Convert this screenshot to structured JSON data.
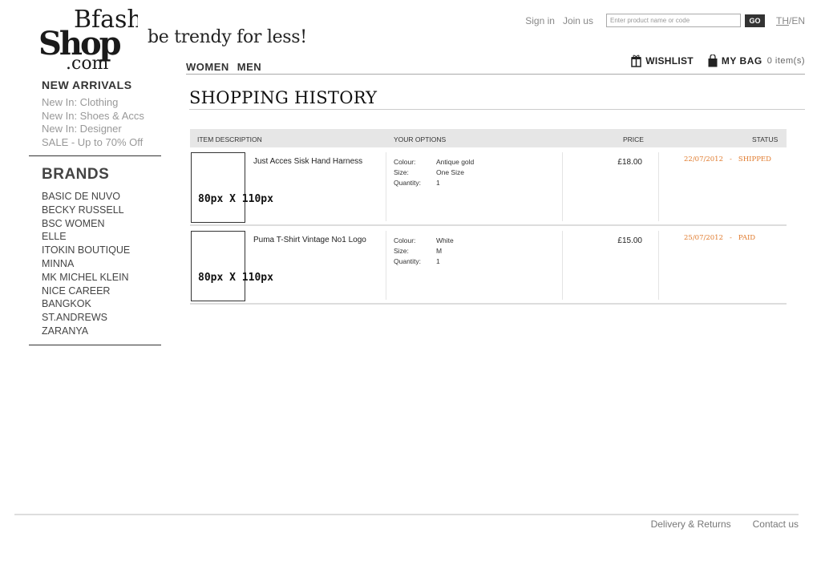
{
  "brand": {
    "logo_line1": "Bfash",
    "logo_line2": "Shop",
    "logo_line3": ".com",
    "tagline": "be trendy for less!"
  },
  "topnav": {
    "sign_in": "Sign in",
    "join_us": "Join us",
    "search_placeholder": "Enter product name or code",
    "go_label": "GO",
    "lang_th": "TH",
    "lang_sep": "/",
    "lang_en": "EN"
  },
  "mainnav": {
    "women": "WOMEN",
    "men": "MEN"
  },
  "util": {
    "wishlist": "WISHLIST",
    "my_bag": "MY BAG",
    "bag_count": "0 item(s)"
  },
  "sidebar": {
    "new_arrivals_heading": "NEW ARRIVALS",
    "new_links": [
      "New In: Clothing",
      "New In: Shoes & Accs",
      "New In: Designer",
      "SALE - Up to 70% Off"
    ],
    "brands_heading": "BRANDS",
    "brands": [
      "BASIC DE NUVO",
      "BECKY RUSSELL",
      "BSC WOMEN",
      "ELLE",
      "ITOKIN BOUTIQUE",
      "MINNA",
      "MK MICHEL KLEIN",
      "NICE CAREER BANGKOK",
      "ST.ANDREWS",
      "ZARANYA"
    ]
  },
  "page": {
    "title": "SHOPPING HISTORY"
  },
  "table": {
    "headers": {
      "item": "ITEM DESCRIPTION",
      "options": "YOUR OPTIONS",
      "price": "PRICE",
      "status": "STATUS"
    },
    "option_labels": {
      "colour": "Colour:",
      "size": "Size:",
      "quantity": "Quantity:"
    },
    "rows": [
      {
        "thumb_label": "80px X 110px",
        "name": "Just Acces Sisk Hand Harness",
        "colour": "Antique gold",
        "size": "One Size",
        "quantity": "1",
        "price": "£18.00",
        "date": "22/07/2012",
        "dash": "-",
        "status": "SHIPPED"
      },
      {
        "thumb_label": "80px X 110px",
        "name": "Puma T-Shirt Vintage No1 Logo",
        "colour": "White",
        "size": "M",
        "quantity": "1",
        "price": "£15.00",
        "date": "25/07/2012",
        "dash": "-",
        "status": "PAID"
      }
    ]
  },
  "footer": {
    "delivery": "Delivery & Returns",
    "contact": "Contact us"
  },
  "colors": {
    "status_accent": "#e07a2c",
    "header_bg": "#e6e6e6"
  },
  "icons": {
    "wishlist": "gift-icon",
    "bag": "shopping-bag-icon"
  }
}
